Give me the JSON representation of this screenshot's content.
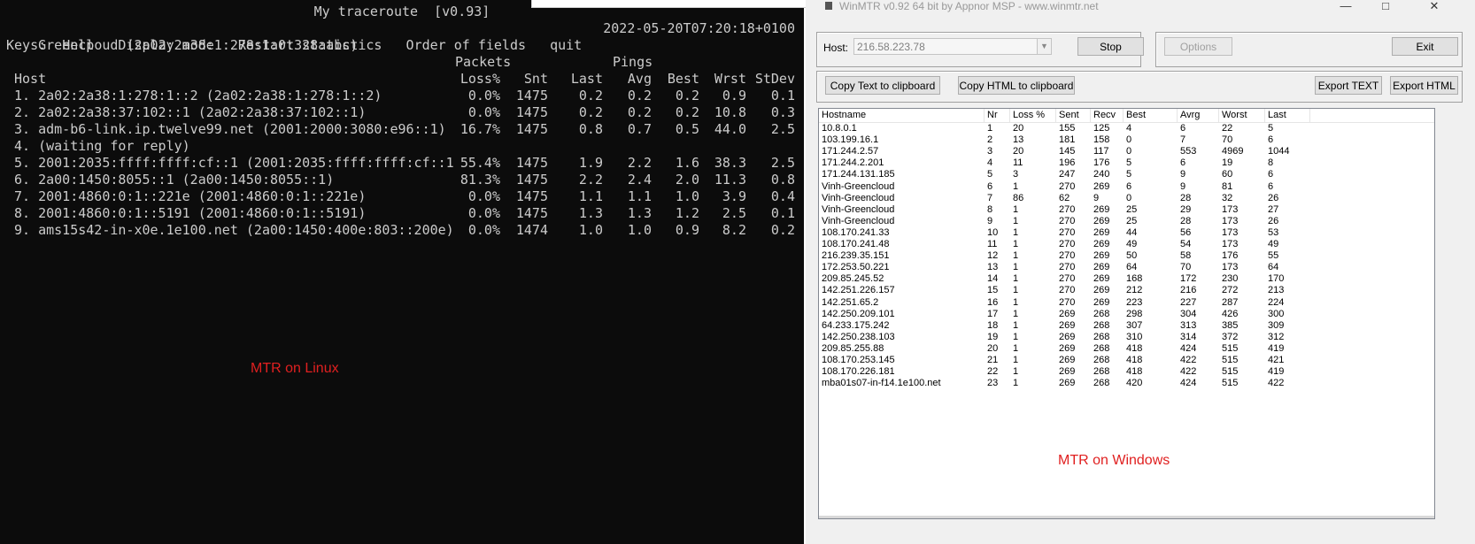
{
  "linux": {
    "title": "My traceroute  [v0.93]",
    "host_line": "Greencloud (2a02:2a38:1:278:1:0:328:abc)",
    "timestamp": "2022-05-20T07:20:18+0100",
    "keys_line": "Keys:  Help   Display mode   Restart statistics   Order of fields   quit",
    "group_packets": "Packets",
    "group_pings": "Pings",
    "headers": [
      "Host",
      "Loss%",
      "Snt",
      "Last",
      "Avg",
      "Best",
      "Wrst",
      "StDev"
    ],
    "rows": [
      {
        "host": "1. 2a02:2a38:1:278:1::2 (2a02:2a38:1:278:1::2)",
        "loss": "0.0%",
        "snt": "1475",
        "last": "0.2",
        "avg": "0.2",
        "best": "0.2",
        "wrst": "0.9",
        "stdev": "0.1"
      },
      {
        "host": "2. 2a02:2a38:37:102::1 (2a02:2a38:37:102::1)",
        "loss": "0.0%",
        "snt": "1475",
        "last": "0.2",
        "avg": "0.2",
        "best": "0.2",
        "wrst": "10.8",
        "stdev": "0.3"
      },
      {
        "host": "3. adm-b6-link.ip.twelve99.net (2001:2000:3080:e96::1)",
        "loss": "16.7%",
        "snt": "1475",
        "last": "0.8",
        "avg": "0.7",
        "best": "0.5",
        "wrst": "44.0",
        "stdev": "2.5"
      },
      {
        "host": "4. (waiting for reply)",
        "loss": "",
        "snt": "",
        "last": "",
        "avg": "",
        "best": "",
        "wrst": "",
        "stdev": ""
      },
      {
        "host": "5. 2001:2035:ffff:ffff:cf::1 (2001:2035:ffff:ffff:cf::1",
        "loss": "55.4%",
        "snt": "1475",
        "last": "1.9",
        "avg": "2.2",
        "best": "1.6",
        "wrst": "38.3",
        "stdev": "2.5"
      },
      {
        "host": "6. 2a00:1450:8055::1 (2a00:1450:8055::1)",
        "loss": "81.3%",
        "snt": "1475",
        "last": "2.2",
        "avg": "2.4",
        "best": "2.0",
        "wrst": "11.3",
        "stdev": "0.8"
      },
      {
        "host": "7. 2001:4860:0:1::221e (2001:4860:0:1::221e)",
        "loss": "0.0%",
        "snt": "1475",
        "last": "1.1",
        "avg": "1.1",
        "best": "1.0",
        "wrst": "3.9",
        "stdev": "0.4"
      },
      {
        "host": "8. 2001:4860:0:1::5191 (2001:4860:0:1::5191)",
        "loss": "0.0%",
        "snt": "1475",
        "last": "1.3",
        "avg": "1.3",
        "best": "1.2",
        "wrst": "2.5",
        "stdev": "0.1"
      },
      {
        "host": "9. ams15s42-in-x0e.1e100.net (2a00:1450:400e:803::200e)",
        "loss": "0.0%",
        "snt": "1474",
        "last": "1.0",
        "avg": "1.0",
        "best": "0.9",
        "wrst": "8.2",
        "stdev": "0.2"
      }
    ],
    "caption": "MTR on Linux"
  },
  "windows": {
    "title": "WinMTR v0.92 64 bit by Appnor MSP - www.winmtr.net",
    "window_controls": [
      "—",
      "□",
      "✕"
    ],
    "host_label": "Host:",
    "host_value": "216.58.223.78",
    "stop_button": "Stop",
    "options_button": "Options",
    "exit_button": "Exit",
    "copy_text_button": "Copy Text to clipboard",
    "copy_html_button": "Copy HTML to clipboard",
    "export_text_button": "Export TEXT",
    "export_html_button": "Export HTML",
    "columns": [
      "Hostname",
      "Nr",
      "Loss %",
      "Sent",
      "Recv",
      "Best",
      "Avrg",
      "Worst",
      "Last"
    ],
    "rows": [
      [
        "10.8.0.1",
        "1",
        "20",
        "155",
        "125",
        "4",
        "6",
        "22",
        "5"
      ],
      [
        "103.199.16.1",
        "2",
        "13",
        "181",
        "158",
        "0",
        "7",
        "70",
        "6"
      ],
      [
        "171.244.2.57",
        "3",
        "20",
        "145",
        "117",
        "0",
        "553",
        "4969",
        "1044"
      ],
      [
        "171.244.2.201",
        "4",
        "11",
        "196",
        "176",
        "5",
        "6",
        "19",
        "8"
      ],
      [
        "171.244.131.185",
        "5",
        "3",
        "247",
        "240",
        "5",
        "9",
        "60",
        "6"
      ],
      [
        "Vinh-Greencloud",
        "6",
        "1",
        "270",
        "269",
        "6",
        "9",
        "81",
        "6"
      ],
      [
        "Vinh-Greencloud",
        "7",
        "86",
        "62",
        "9",
        "0",
        "28",
        "32",
        "26"
      ],
      [
        "Vinh-Greencloud",
        "8",
        "1",
        "270",
        "269",
        "25",
        "29",
        "173",
        "27"
      ],
      [
        "Vinh-Greencloud",
        "9",
        "1",
        "270",
        "269",
        "25",
        "28",
        "173",
        "26"
      ],
      [
        "108.170.241.33",
        "10",
        "1",
        "270",
        "269",
        "44",
        "56",
        "173",
        "53"
      ],
      [
        "108.170.241.48",
        "11",
        "1",
        "270",
        "269",
        "49",
        "54",
        "173",
        "49"
      ],
      [
        "216.239.35.151",
        "12",
        "1",
        "270",
        "269",
        "50",
        "58",
        "176",
        "55"
      ],
      [
        "172.253.50.221",
        "13",
        "1",
        "270",
        "269",
        "64",
        "70",
        "173",
        "64"
      ],
      [
        "209.85.245.52",
        "14",
        "1",
        "270",
        "269",
        "168",
        "172",
        "230",
        "170"
      ],
      [
        "142.251.226.157",
        "15",
        "1",
        "270",
        "269",
        "212",
        "216",
        "272",
        "213"
      ],
      [
        "142.251.65.2",
        "16",
        "1",
        "270",
        "269",
        "223",
        "227",
        "287",
        "224"
      ],
      [
        "142.250.209.101",
        "17",
        "1",
        "269",
        "268",
        "298",
        "304",
        "426",
        "300"
      ],
      [
        "64.233.175.242",
        "18",
        "1",
        "269",
        "268",
        "307",
        "313",
        "385",
        "309"
      ],
      [
        "142.250.238.103",
        "19",
        "1",
        "269",
        "268",
        "310",
        "314",
        "372",
        "312"
      ],
      [
        "209.85.255.88",
        "20",
        "1",
        "269",
        "268",
        "418",
        "424",
        "515",
        "419"
      ],
      [
        "108.170.253.145",
        "21",
        "1",
        "269",
        "268",
        "418",
        "422",
        "515",
        "421"
      ],
      [
        "108.170.226.181",
        "22",
        "1",
        "269",
        "268",
        "418",
        "422",
        "515",
        "419"
      ],
      [
        "mba01s07-in-f14.1e100.net",
        "23",
        "1",
        "269",
        "268",
        "420",
        "424",
        "515",
        "422"
      ]
    ],
    "caption": "MTR on Windows"
  }
}
